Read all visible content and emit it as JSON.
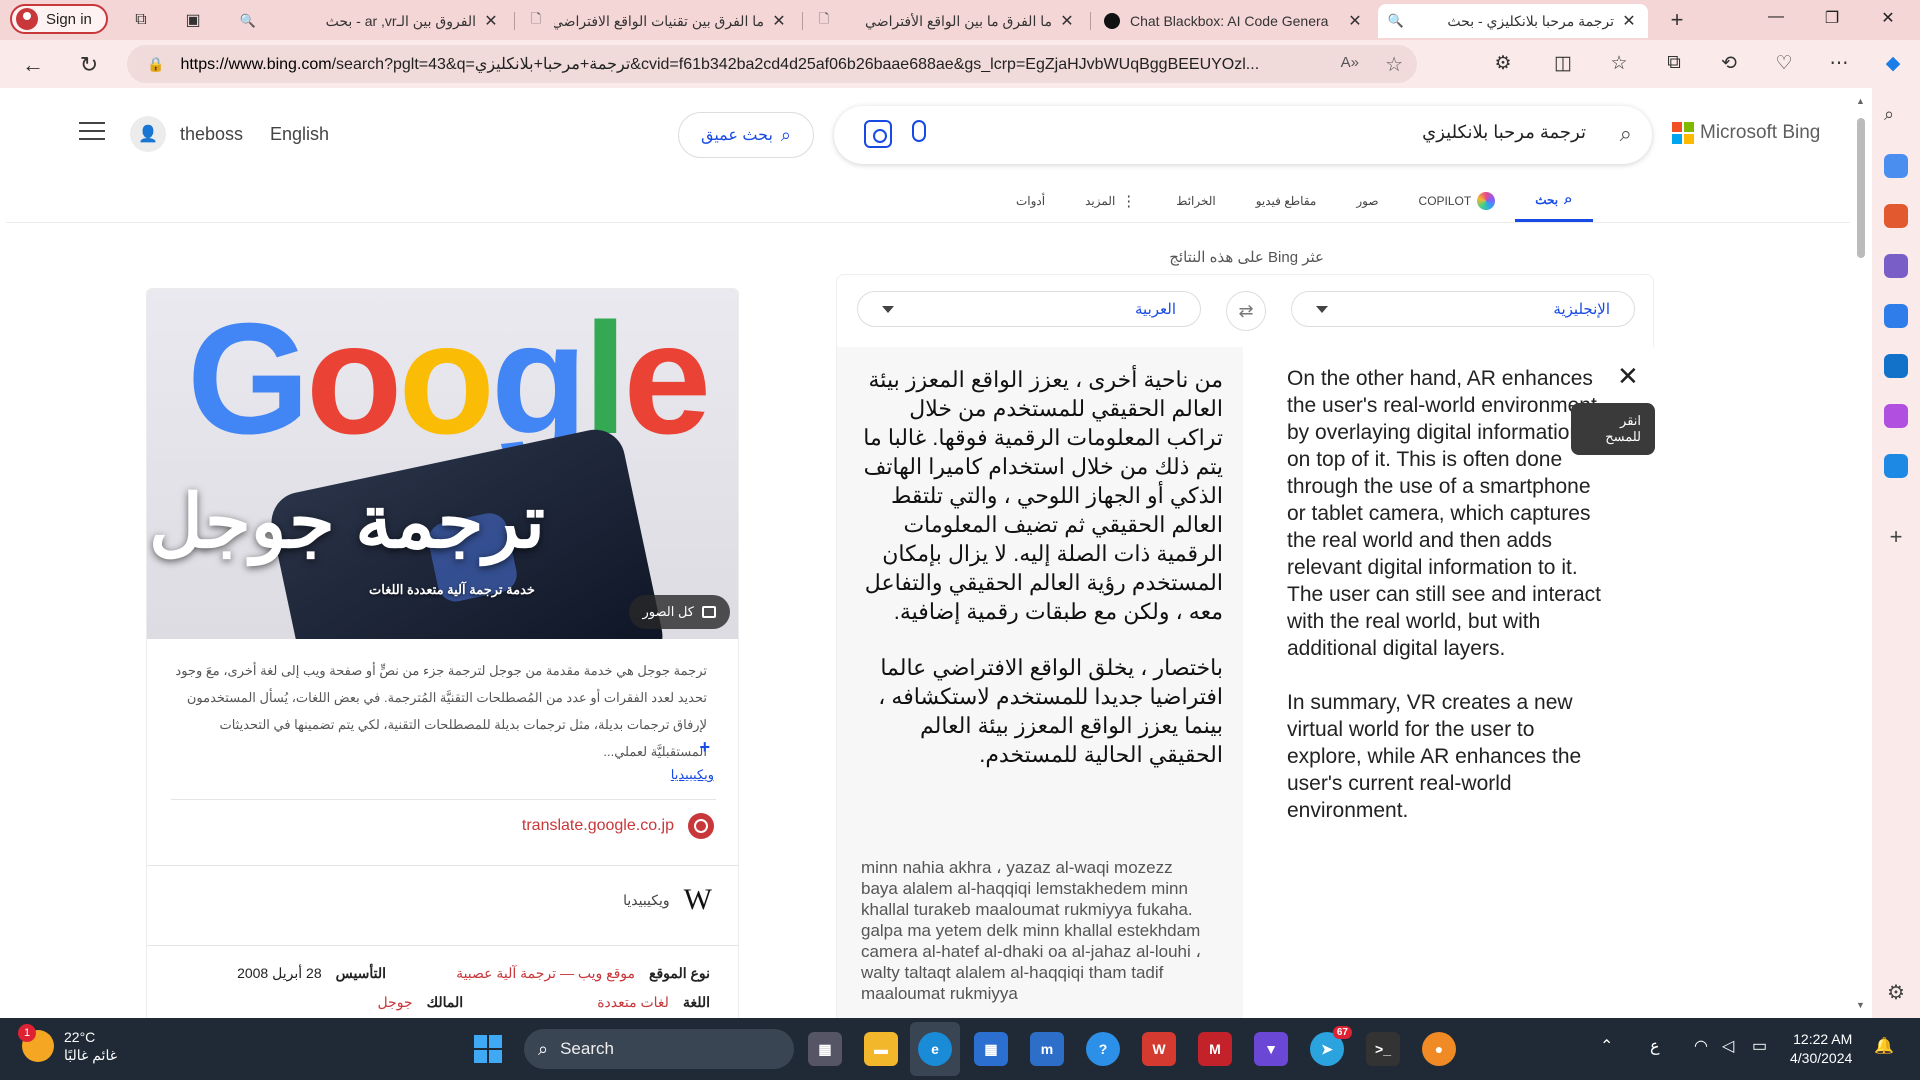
{
  "browser": {
    "signin_label": "Sign in",
    "tabs": [
      {
        "title": "الفروق بين الـar ,vr - بحث",
        "icon": "search-icon"
      },
      {
        "title": "ما الفرق بين تقنيات الواقع الافتراضي",
        "icon": "page-icon"
      },
      {
        "title": "ما الفرق ما بين الواقع الأفتراضي",
        "icon": "page-icon"
      },
      {
        "title": "Chat Blackbox: AI Code Genera",
        "icon": "blackbox-icon"
      },
      {
        "title": "ترجمة مرحبا بلانكليزي - بحث",
        "icon": "search-icon"
      }
    ],
    "url_prefix": "https://www.bing.com",
    "url_rest": "/search?pglt=43&q=ترجمة+مرحبا+بلانكليزي&cvid=f61b342ba2cd4d25af06b26baae688ae&gs_lcrp=EgZjaHJvbWUqBggBEEUYOzl..."
  },
  "bing": {
    "username": "theboss",
    "language_link": "English",
    "deep_search_label": "بحث عميق",
    "query": "ترجمة مرحبا بلانكليزي",
    "brand": "Microsoft Bing",
    "scopes": {
      "search": "بحث",
      "copilot": "COPILOT",
      "images": "صور",
      "videos": "مقاطع فيديو",
      "maps": "الخرائط",
      "more": "المزيد",
      "tools": "أدوات"
    },
    "filter_note": "عثر Bing على هذه النتائج"
  },
  "translator": {
    "source_lang": "الإنجليزية",
    "target_lang": "العربية",
    "source_paragraphs": [
      "On the other hand, AR enhances the user's real-world environment by overlaying digital information on top of it. This is often done through the use of a smartphone or tablet camera, which captures the real world and then adds relevant digital information to it. The user can still see and interact with the real world, but with additional digital layers.",
      "In summary, VR creates a new virtual world for the user to explore, while AR enhances the user's current real-world environment."
    ],
    "target_paragraphs": [
      "من ناحية أخرى ، يعزز الواقع المعزز بيئة العالم الحقيقي للمستخدم من خلال تراكب المعلومات الرقمية فوقها. غالبا ما يتم ذلك من خلال استخدام كاميرا الهاتف الذكي أو الجهاز اللوحي ، والتي تلتقط العالم الحقيقي ثم تضيف المعلومات الرقمية ذات الصلة إليه. لا يزال بإمكان المستخدم رؤية العالم الحقيقي والتفاعل معه ، ولكن مع طبقات رقمية إضافية.",
      "باختصار ، يخلق الواقع الافتراضي عالما افتراضيا جديدا للمستخدم لاستكشافه ، بينما يعزز الواقع المعزز بيئة العالم الحقيقي الحالية للمستخدم."
    ],
    "transliteration": "minn nahia akhra ، yazaz al-waqi mozezz baya alalem al-haqqiqi lemstakhedem minn khallal turakeb maaloumat rukmiyya fukaha. galpa ma yetem delk minn khallal estekhdam camera al-hatef al-dhaki oa al-jahaz al-louhi ، walty taltaqt alalem al-haqqiqi tham tadif maaloumat rukmiyya",
    "clear_tooltip": "انقر للمسح"
  },
  "knowledge": {
    "image_title": "ترجمة جوجل",
    "image_logo_text": "Google",
    "image_subtitle": "خدمة ترجمة آلية متعددة اللغات",
    "all_images": "كل الصور",
    "description": "ترجمة جوجل  هي خدمة مقدمة من جوجل لترجمة جزء من نصٍّ أو صفحة ويب إلى لغة أخرى، معَ وجود تحديد لعدد الفقرات أو عدد من المُصطلحات التقنيَّة المُترجمة. في بعض اللغات، يُسأل المستخدمون لإرفاق ترجمات بديلة، مثل ترجمات بديلة للمصطلحات التقنية، لكي يتم تضمينها في التحديثات المستقبليَّة لعملي...",
    "more": "+",
    "wiki_link": "ويكيبيديا",
    "site": "translate.google.co.jp",
    "wiki_label": "ويكيبيديا",
    "facts": [
      {
        "k": "نوع الموقع",
        "v": "موقع ويب — ترجمة آلية عصبية",
        "k2": "التأسيس",
        "v2": "28 أبريل 2008"
      },
      {
        "k": "اللغة",
        "v": "لغات متعددة",
        "k2": "المالك",
        "v2": "جوجل"
      }
    ]
  },
  "taskbar": {
    "temp": "22°C",
    "weather": "غائم غالبًا",
    "weather_badge": "1",
    "search_label": "Search",
    "telegram_badge": "67",
    "lang_indicator": "ع",
    "time": "12:22 AM",
    "date": "4/30/2024"
  }
}
